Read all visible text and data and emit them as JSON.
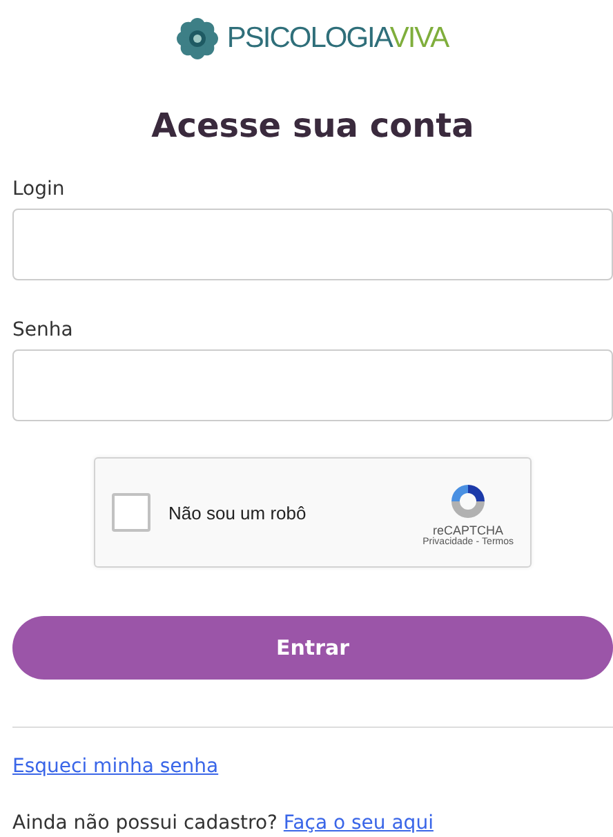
{
  "logo": {
    "name_main": "PSICOLOGIA",
    "name_accent": "VIVA"
  },
  "title": "Acesse sua conta",
  "fields": [
    {
      "label": "Login"
    },
    {
      "label": "Senha"
    }
  ],
  "captcha": {
    "label": "Não sou um robô",
    "checked": false,
    "brand": "reCAPTCHA",
    "privacy": "Privacidade",
    "separator": "-",
    "terms": "Termos"
  },
  "submit": "Entrar",
  "forgot_link": "Esqueci minha senha",
  "signup": {
    "text": "Ainda não possui cadastro?",
    "link": "Faça o seu aqui"
  }
}
